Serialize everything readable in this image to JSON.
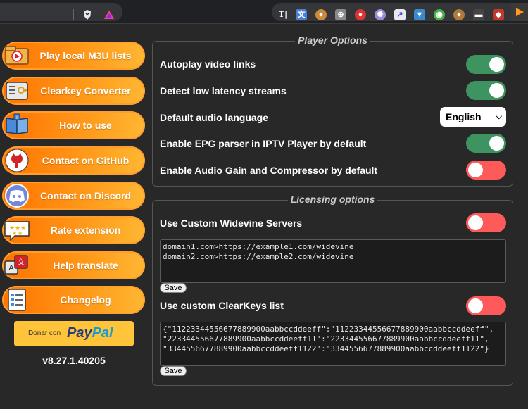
{
  "sidebar": {
    "items": [
      {
        "label": "Play local M3U lists",
        "icon": "video-folder-icon"
      },
      {
        "label": "Clearkey Converter",
        "icon": "key-converter-icon"
      },
      {
        "label": "How to use",
        "icon": "book-icon"
      },
      {
        "label": "Contact on GitHub",
        "icon": "github-icon"
      },
      {
        "label": "Contact on Discord",
        "icon": "discord-icon"
      },
      {
        "label": "Rate extension",
        "icon": "rating-stars-icon"
      },
      {
        "label": "Help translate",
        "icon": "translate-icon"
      },
      {
        "label": "Changelog",
        "icon": "checklist-icon"
      }
    ],
    "donate": {
      "small": "Donar con",
      "brand_a": "Pay",
      "brand_b": "Pal"
    },
    "version": "v8.27.1.40205"
  },
  "player_options": {
    "legend": "Player Options",
    "rows": [
      {
        "label": "Autoplay video links",
        "state": "on"
      },
      {
        "label": "Detect low latency streams",
        "state": "on"
      },
      {
        "label": "Default audio language",
        "select_value": "English"
      },
      {
        "label": "Enable EPG parser in IPTV Player by default",
        "state": "on"
      },
      {
        "label": "Enable Audio Gain and Compressor by default",
        "state": "off"
      }
    ]
  },
  "licensing": {
    "legend": "Licensing options",
    "widevine_label": "Use Custom Widevine Servers",
    "widevine_state": "off",
    "widevine_text": "domain1.com>https://example1.com/widevine\ndomain2.com>https://example2.com/widevine",
    "clearkeys_label": "Use custom ClearKeys list",
    "clearkeys_state": "off",
    "clearkeys_text": "{\"11223344556677889900aabbccddeeff\":\"11223344556677889900aabbccddeeff\",\n\"223344556677889900aabbccddeeff11\":\"223344556677889900aabbccddeeff11\",\n\"3344556677889900aabbccddeeff1122\":\"3344556677889900aabbccddeeff1122\"}",
    "save_label": "Save"
  },
  "colors": {
    "toggle_on": "#3e9460",
    "toggle_off": "#ff5a5a",
    "button_orange": "#ff8a0f"
  }
}
